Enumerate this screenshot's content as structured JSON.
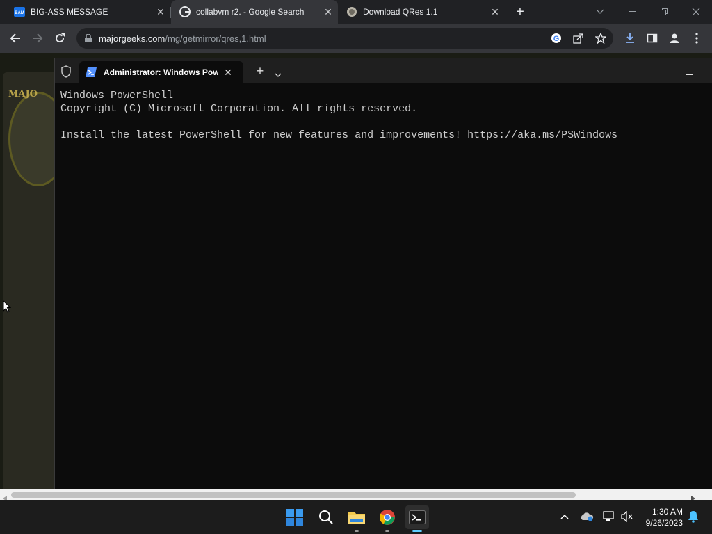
{
  "browser": {
    "tabs": [
      {
        "title": "BIG-ASS MESSAGE",
        "favicon": "bam-favicon"
      },
      {
        "title": "collabvm r2. - Google Search",
        "favicon": "google-favicon"
      },
      {
        "title": "Download QRes 1.1",
        "favicon": "majorgeeks-favicon"
      }
    ],
    "url_host": "majorgeeks.com",
    "url_path": "/mg/getmirror/qres,1.html",
    "favicon_bam_text": "BAM"
  },
  "page_bg": {
    "logo_text": "MAJO"
  },
  "terminal": {
    "tab_title": "Administrator: Windows PowerShell",
    "lines": [
      "Windows PowerShell",
      "Copyright (C) Microsoft Corporation. All rights reserved.",
      "",
      "Install the latest PowerShell for new features and improvements! https://aka.ms/PSWindows"
    ]
  },
  "taskbar": {
    "time": "1:30 AM",
    "date": "9/26/2023"
  },
  "colors": {
    "chrome_bg": "#202124",
    "chrome_toolbar": "#35363a",
    "terminal_bg": "#0c0c0c",
    "taskbar_bg": "#1c1c1c",
    "windows_blue": "#0078d4"
  }
}
